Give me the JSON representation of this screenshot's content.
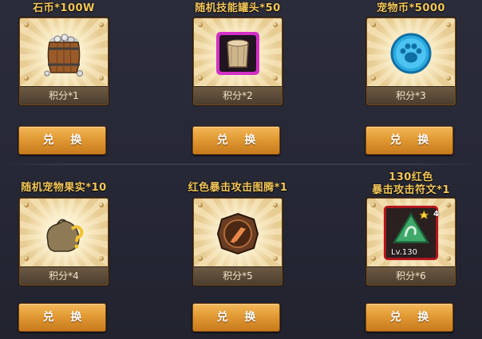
{
  "items": [
    {
      "title": "石币*100W",
      "points": "积分*1",
      "button": "兑 换",
      "icon": "coin-barrel-icon"
    },
    {
      "title": "随机技能罐头*50",
      "points": "积分*2",
      "button": "兑 换",
      "icon": "skill-can-icon"
    },
    {
      "title": "宠物币*5000",
      "points": "积分*3",
      "button": "兑 换",
      "icon": "pet-coin-icon"
    },
    {
      "title": "随机宠物果实*10",
      "points": "积分*4",
      "button": "兑 换",
      "icon": "fruit-sack-icon"
    },
    {
      "title": "红色暴击攻击图腾*1",
      "points": "积分*5",
      "button": "兑 换",
      "icon": "crit-totem-icon"
    },
    {
      "title_line1": "130红色",
      "title_line2": "暴击攻击符文*1",
      "points": "积分*6",
      "button": "兑 换",
      "icon": "rune-icon",
      "rune_level": "Lv.130",
      "rune_star": "4"
    }
  ]
}
